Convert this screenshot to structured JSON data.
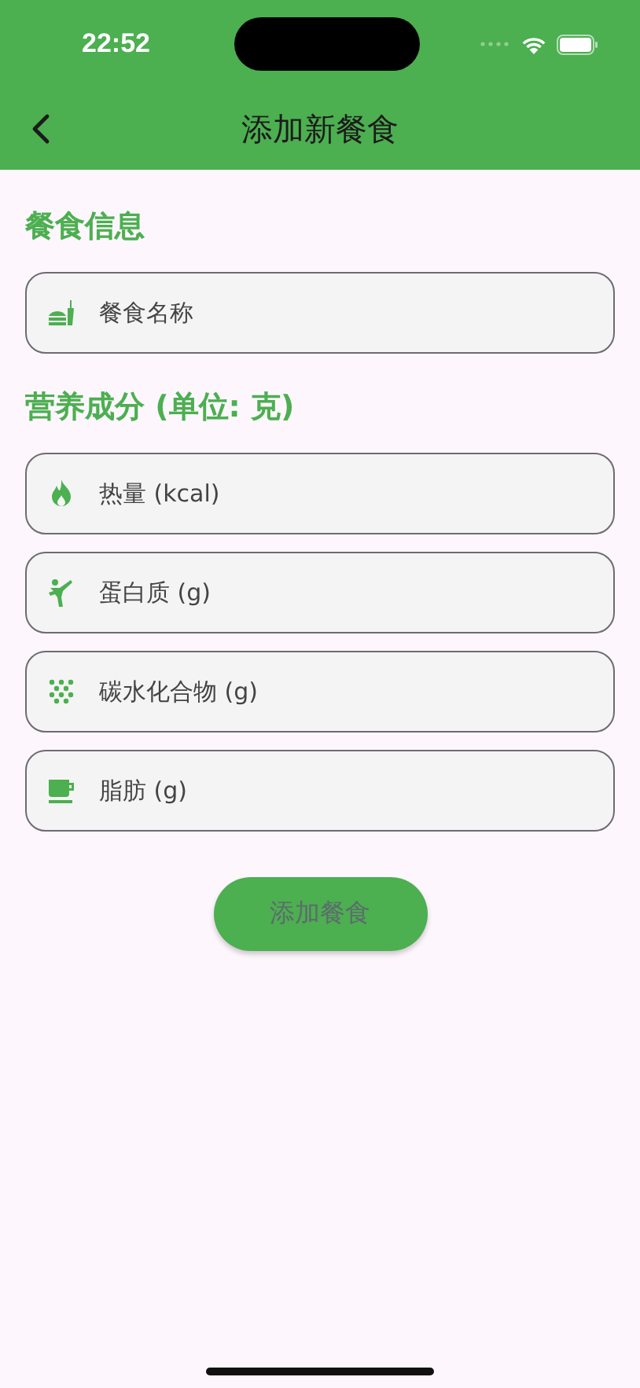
{
  "status_bar": {
    "time": "22:52"
  },
  "header": {
    "title": "添加新餐食"
  },
  "sections": [
    {
      "title": "餐食信息",
      "fields": [
        {
          "placeholder": "餐食名称"
        }
      ]
    },
    {
      "title": "营养成分 (单位: 克)",
      "fields": [
        {
          "placeholder": "热量 (kcal)"
        },
        {
          "placeholder": "蛋白质 (g)"
        },
        {
          "placeholder": "碳水化合物 (g)"
        },
        {
          "placeholder": "脂肪 (g)"
        }
      ]
    }
  ],
  "submit_button": {
    "label": "添加餐食"
  }
}
